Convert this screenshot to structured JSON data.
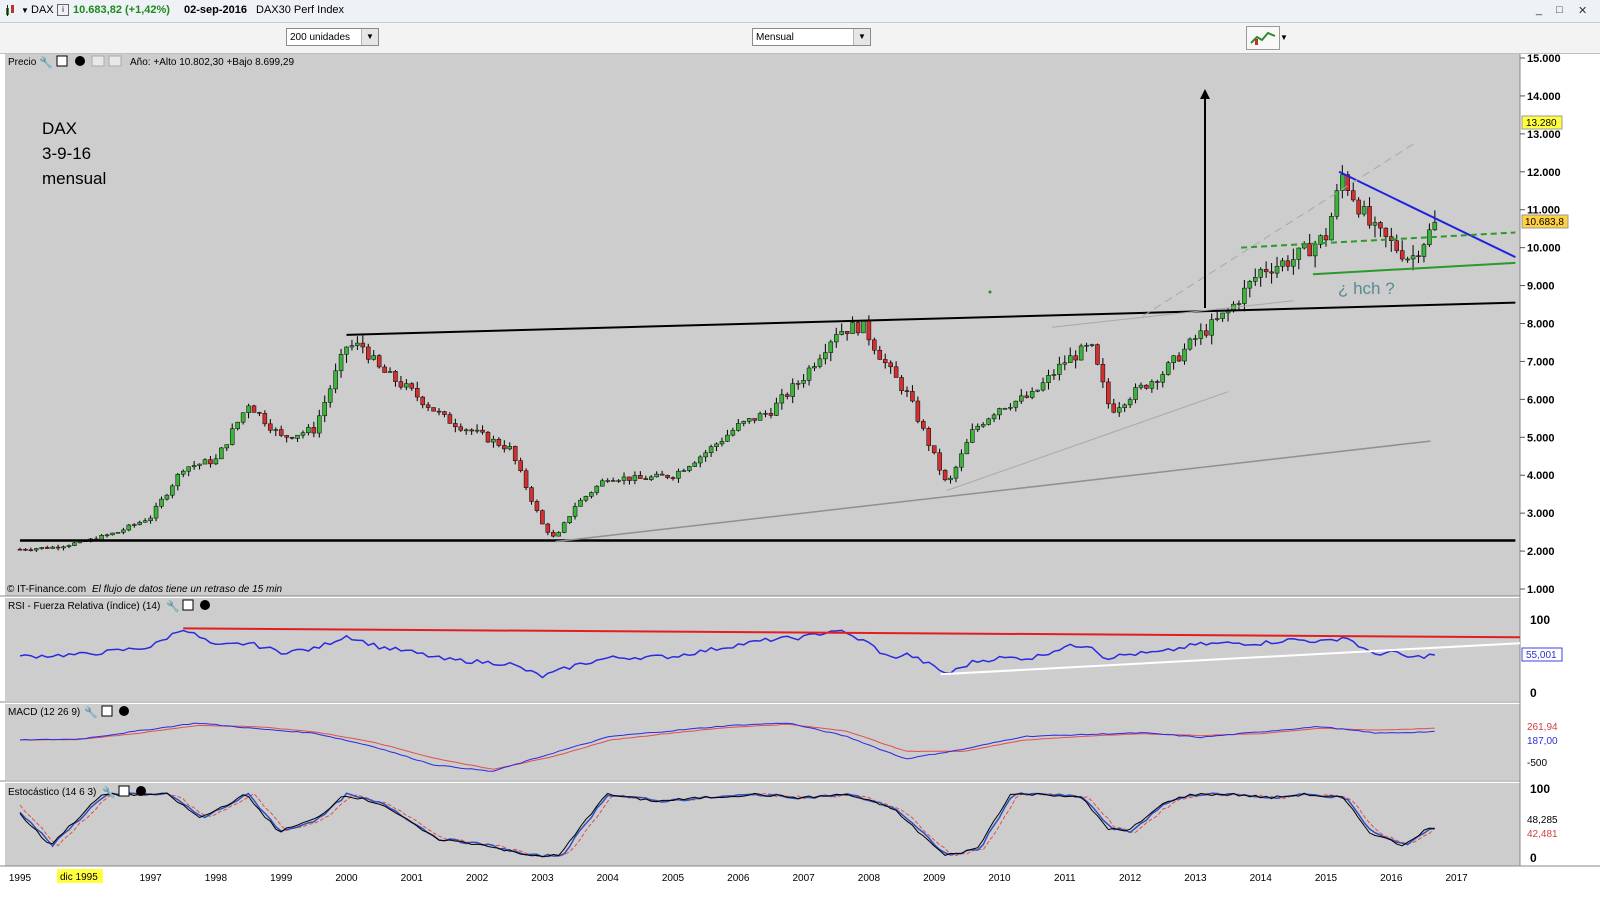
{
  "window": {
    "symbol": "DAX",
    "price_info": "10.683,82 (+1,42%)",
    "date": "02-sep-2016",
    "instrument": "DAX30 Perf Index",
    "minimize": "_",
    "maximize": "□",
    "close": "✕"
  },
  "toolbar": {
    "units_select": "200 unidades",
    "period_select": "Mensual"
  },
  "price_panel": {
    "title": "Precio",
    "range_info": "Año: +Alto 10.802,30 +Bajo 8.699,29",
    "annotation_lines": [
      "DAX",
      "3-9-16",
      "mensual"
    ],
    "pattern_note": "¿ hch ?",
    "footer_source": "© IT-Finance.com",
    "footer_note": "El flujo de datos tiene un retraso de 15 min",
    "last_price_badge": "10.683,8",
    "target_badge": "13.280"
  },
  "rsi_panel": {
    "title": "RSI - Fuerza Relativa (índice) (14)",
    "last_badge": "55,001"
  },
  "macd_panel": {
    "title": "MACD (12 26 9)",
    "badges": [
      "261,94",
      "187,00"
    ]
  },
  "stoch_panel": {
    "title": "Estocástico (14 6 3)",
    "badges": [
      "48,285",
      "42,481"
    ]
  },
  "x_axis": {
    "highlight_label": "dic 1995"
  },
  "chart_data": [
    {
      "type": "candlestick",
      "title": "DAX",
      "period": "monthly",
      "y_ticks": [
        "1.000",
        "2.000",
        "3.000",
        "4.000",
        "5.000",
        "6.000",
        "7.000",
        "8.000",
        "9.000",
        "10.000",
        "11.000",
        "12.000",
        "13.000",
        "14.000",
        "15.000"
      ],
      "x_ticks": [
        "1995",
        "1997",
        "1998",
        "1999",
        "2000",
        "2001",
        "2002",
        "2003",
        "2004",
        "2005",
        "2006",
        "2007",
        "2008",
        "2009",
        "2010",
        "2011",
        "2012",
        "2013",
        "2014",
        "2015",
        "2016",
        "2017"
      ],
      "ylim": [
        1000,
        15000
      ],
      "x_approx_years": [
        1995.0,
        1995.5,
        1996.0,
        1996.5,
        1997.0,
        1997.5,
        1998.0,
        1998.5,
        1999.0,
        1999.5,
        2000.0,
        2000.25,
        2000.5,
        2001.0,
        2001.5,
        2002.0,
        2002.5,
        2003.0,
        2003.2,
        2003.5,
        2004.0,
        2004.5,
        2005.0,
        2005.5,
        2006.0,
        2006.5,
        2007.0,
        2007.5,
        2007.9,
        2008.3,
        2008.6,
        2009.0,
        2009.2,
        2009.6,
        2010.0,
        2010.5,
        2011.0,
        2011.4,
        2011.7,
        2012.0,
        2012.5,
        2013.0,
        2013.5,
        2014.0,
        2014.5,
        2015.0,
        2015.25,
        2015.7,
        2016.0,
        2016.3,
        2016.7
      ],
      "close_approx": [
        2050,
        2100,
        2250,
        2500,
        2900,
        4200,
        4400,
        5900,
        5000,
        5200,
        7400,
        7400,
        6800,
        6200,
        5500,
        5100,
        4700,
        2700,
        2300,
        3200,
        3950,
        3900,
        4000,
        4600,
        5300,
        5700,
        6600,
        7800,
        7950,
        6800,
        6100,
        4500,
        3700,
        5200,
        5800,
        6100,
        7000,
        7400,
        5700,
        6100,
        6700,
        7600,
        8300,
        9400,
        9700,
        10300,
        11900,
        10500,
        10100,
        9700,
        10684
      ],
      "trendlines": [
        {
          "name": "neckline/resistance",
          "from": {
            "x": 2000.0,
            "y": 7700
          },
          "to": {
            "x": 2017.9,
            "y": 8550
          }
        },
        {
          "name": "support",
          "from": {
            "x": 1995.0,
            "y": 2280
          },
          "to": {
            "x": 2017.9,
            "y": 2280
          }
        },
        {
          "name": "triangle upper",
          "from": {
            "x": 2015.2,
            "y": 12000
          },
          "to": {
            "x": 2017.9,
            "y": 9750
          }
        },
        {
          "name": "triangle lower",
          "from": {
            "x": 2014.8,
            "y": 9300
          },
          "to": {
            "x": 2017.9,
            "y": 9600
          }
        },
        {
          "name": "trend 2003",
          "from": {
            "x": 2003.2,
            "y": 2250
          },
          "to": {
            "x": 2016.6,
            "y": 4900
          }
        }
      ],
      "target_price": 13280
    },
    {
      "type": "line",
      "title": "RSI - Fuerza Relativa (índice) (14)",
      "y_ticks": [
        "0",
        "100"
      ],
      "ylim": [
        0,
        100
      ],
      "x": [
        1995.0,
        1996.0,
        1997.0,
        1997.5,
        1998.0,
        1998.5,
        1999.0,
        1999.5,
        2000.0,
        2000.5,
        2001.0,
        2001.5,
        2002.0,
        2002.5,
        2003.0,
        2003.5,
        2004.0,
        2005.0,
        2006.0,
        2006.5,
        2007.0,
        2007.5,
        2008.0,
        2008.3,
        2008.6,
        2009.0,
        2009.2,
        2009.6,
        2010.0,
        2010.5,
        2011.0,
        2011.4,
        2011.6,
        2012.0,
        2012.5,
        2013.0,
        2013.5,
        2014.0,
        2014.5,
        2015.0,
        2015.3,
        2015.7,
        2016.0,
        2016.3,
        2016.7
      ],
      "values": [
        52,
        55,
        65,
        90,
        66,
        70,
        58,
        62,
        80,
        65,
        58,
        48,
        45,
        42,
        25,
        40,
        50,
        52,
        68,
        75,
        78,
        88,
        70,
        50,
        55,
        38,
        28,
        45,
        50,
        50,
        65,
        68,
        50,
        55,
        58,
        68,
        70,
        70,
        75,
        72,
        79,
        55,
        58,
        50,
        55
      ],
      "last": 55.001
    },
    {
      "type": "line",
      "title": "MACD (12 26 9)",
      "series": [
        {
          "name": "MACD",
          "values": [
            0,
            20,
            200,
            380,
            250,
            150,
            -150,
            -550,
            -700,
            -300,
            80,
            200,
            320,
            380,
            80,
            -420,
            -200,
            80,
            120,
            160,
            60,
            180,
            300,
            150,
            187
          ]
        },
        {
          "name": "Signal",
          "values": [
            0,
            10,
            150,
            320,
            300,
            180,
            -50,
            -400,
            -650,
            -380,
            0,
            150,
            280,
            350,
            200,
            -250,
            -250,
            0,
            80,
            140,
            100,
            140,
            260,
            220,
            262
          ]
        }
      ],
      "last": [
        261.94,
        187.0
      ],
      "y_ticks": [
        "-500"
      ]
    },
    {
      "type": "line",
      "title": "Estocástico (14 6 3)",
      "y_ticks": [
        "0",
        "100"
      ],
      "ylim": [
        0,
        100
      ],
      "last": [
        48.285,
        42.481
      ]
    }
  ]
}
